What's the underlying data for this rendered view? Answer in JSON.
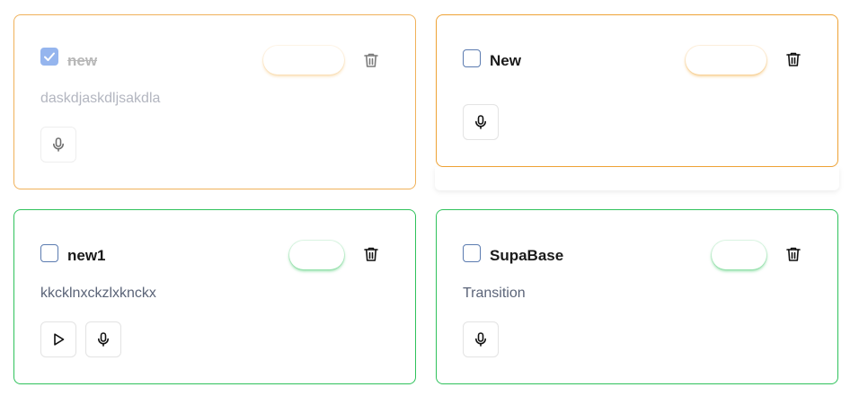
{
  "todos": [
    {
      "title": "new",
      "description": "daskdjaskdljsakdla",
      "completed": true
    },
    {
      "title": "New",
      "description": "",
      "completed": false
    },
    {
      "title": "new1",
      "description": "kkcklnxckzlxknckx",
      "completed": false
    },
    {
      "title": "SupaBase",
      "description": "Transition",
      "completed": false
    }
  ],
  "icons": {
    "delete": "trash-icon",
    "record": "microphone-icon",
    "play": "play-icon",
    "check": "checkmark-icon"
  },
  "colors": {
    "orange_border": "#f0b15a",
    "green_border": "#2fc25b",
    "checkbox_checked": "#5e8ee6"
  }
}
